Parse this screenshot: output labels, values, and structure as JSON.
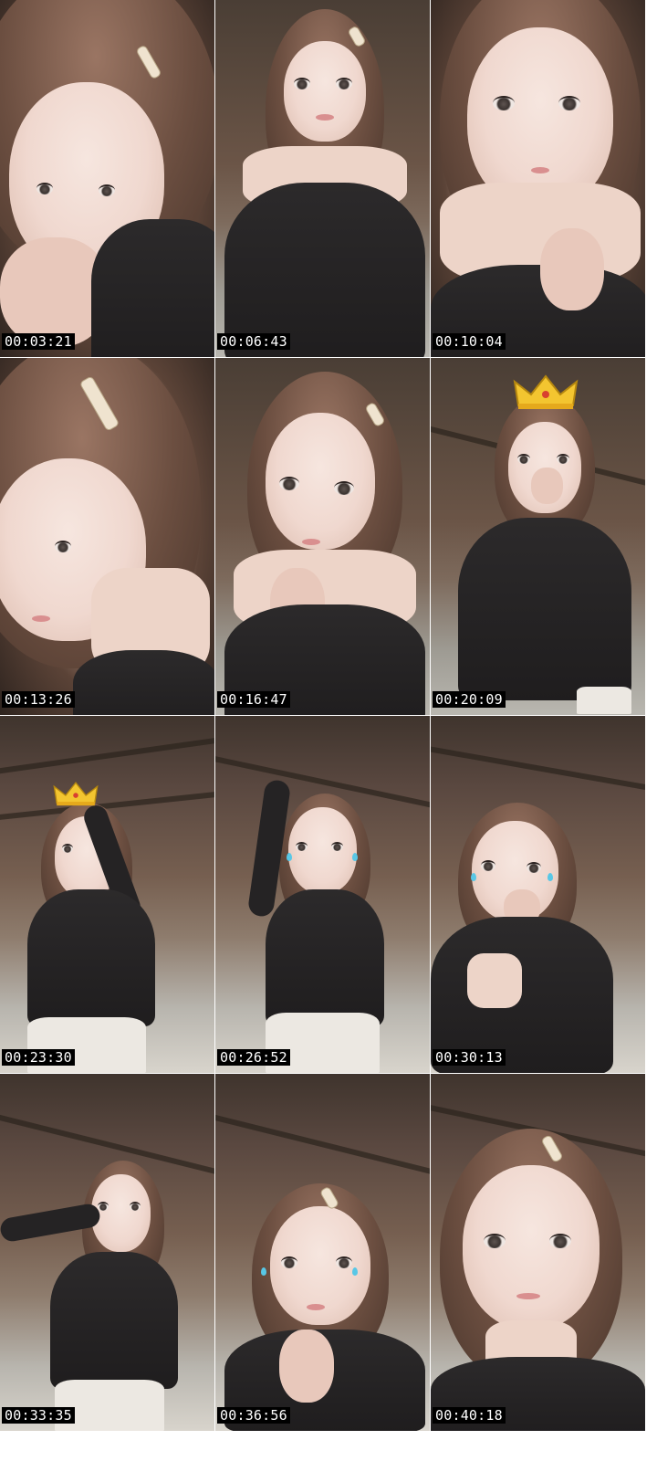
{
  "contact_sheet": {
    "frames": [
      {
        "timestamp": "00:03:21",
        "scene": "closeup"
      },
      {
        "timestamp": "00:06:43",
        "scene": "bust"
      },
      {
        "timestamp": "00:10:04",
        "scene": "closeup"
      },
      {
        "timestamp": "00:13:26",
        "scene": "closeup"
      },
      {
        "timestamp": "00:16:47",
        "scene": "bust"
      },
      {
        "timestamp": "00:20:09",
        "scene": "bust-crown"
      },
      {
        "timestamp": "00:23:30",
        "scene": "full-crown"
      },
      {
        "timestamp": "00:26:52",
        "scene": "full"
      },
      {
        "timestamp": "00:30:13",
        "scene": "bust"
      },
      {
        "timestamp": "00:33:35",
        "scene": "full"
      },
      {
        "timestamp": "00:36:56",
        "scene": "bust"
      },
      {
        "timestamp": "00:40:18",
        "scene": "closeup"
      }
    ]
  },
  "colors": {
    "timestamp_bg": "#000000",
    "timestamp_fg": "#ffffff",
    "top_color": "#262425",
    "skirt_color": "#ece8e2",
    "crown_color": "#f3c530"
  }
}
